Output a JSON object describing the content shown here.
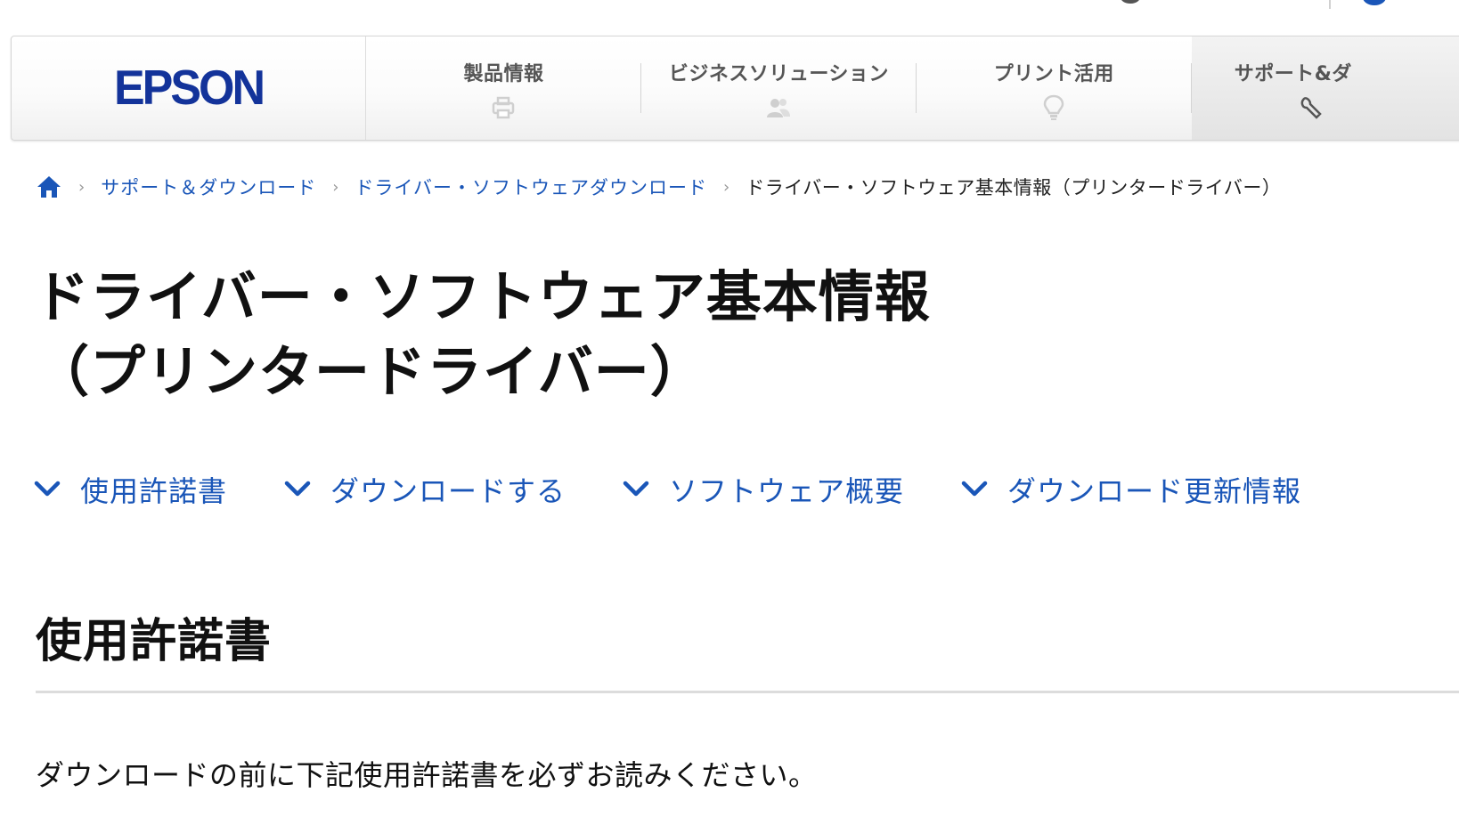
{
  "header": {
    "logo_text": "EPSON",
    "nav_items": [
      {
        "label": "製品情報",
        "icon": "printer-icon"
      },
      {
        "label": "ビジネスソリューション",
        "icon": "people-icon"
      },
      {
        "label": "プリント活用",
        "icon": "lightbulb-icon"
      },
      {
        "label": "サポート&ダ",
        "icon": "wrench-icon"
      }
    ]
  },
  "breadcrumb": {
    "home_icon": "home-icon",
    "items": [
      {
        "label": "サポート＆ダウンロード"
      },
      {
        "label": "ドライバー・ソフトウェアダウンロード"
      }
    ],
    "current": "ドライバー・ソフトウェア基本情報（プリンタードライバー）"
  },
  "page": {
    "title_line1": "ドライバー・ソフトウェア基本情報",
    "title_line2": "（プリンタードライバー）"
  },
  "anchor_nav": [
    {
      "label": "使用許諾書"
    },
    {
      "label": "ダウンロードする"
    },
    {
      "label": "ソフトウェア概要"
    },
    {
      "label": "ダウンロード更新情報"
    }
  ],
  "section": {
    "title": "使用許諾書",
    "text": "ダウンロードの前に下記使用許諾書を必ずお読みください。"
  },
  "colors": {
    "brand": "#13339a",
    "link": "#1a56b8",
    "text": "#111111"
  }
}
